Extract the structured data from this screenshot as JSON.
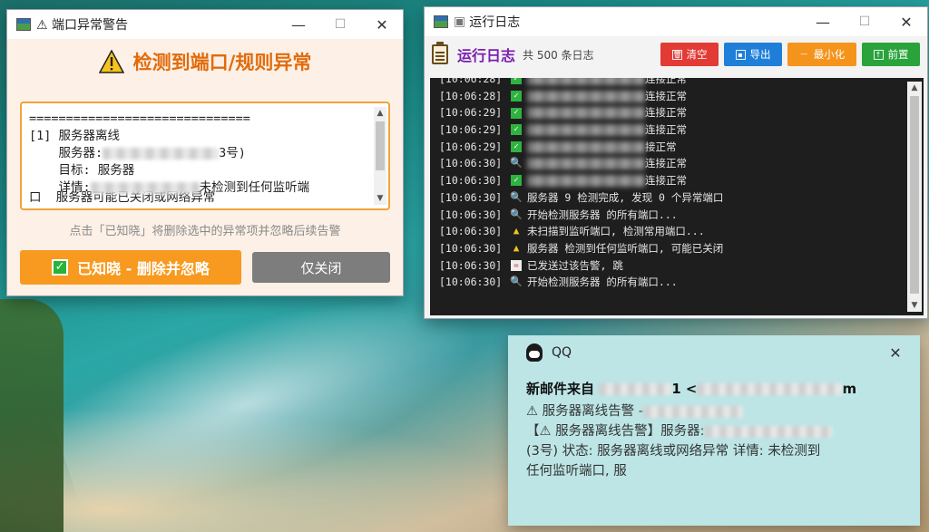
{
  "alert_window": {
    "title": "⚠ 端口异常警告",
    "heading": "检测到端口/规则异常",
    "separator": "==============================",
    "item_header": "[1] 服务器离线",
    "server_label": "    服务器:",
    "server_suffix": "3号)",
    "target_line": "    目标: 服务器",
    "detail_label": "    详情:",
    "detail_suffix": "未检测到任何监听端",
    "cut_line": "口  服务器可能已关闭或网络异常",
    "hint": "点击「已知晓」将删除选中的异常项并忽略后续告警",
    "ack_button": "已知晓 - 删除并忽略",
    "close_button": "仅关闭"
  },
  "log_window": {
    "title": "运行日志",
    "heading": "运行日志",
    "count_text": "共 500 条日志",
    "buttons": {
      "clear": "清空",
      "export": "导出",
      "minimize": "最小化",
      "pin_top": "前置"
    },
    "lines": [
      {
        "time": "[10:06:28]",
        "mark": "ok",
        "text": "连接正常"
      },
      {
        "time": "[10:06:28]",
        "mark": "ok",
        "text": "连接正常"
      },
      {
        "time": "[10:06:29]",
        "mark": "ok",
        "text": "连接正常"
      },
      {
        "time": "[10:06:29]",
        "mark": "ok",
        "text": "连接正常"
      },
      {
        "time": "[10:06:29]",
        "mark": "ok",
        "text": "接正常"
      },
      {
        "time": "[10:06:30]",
        "mark": "search",
        "text": "连接正常"
      },
      {
        "time": "[10:06:30]",
        "mark": "ok",
        "text": "连接正常"
      },
      {
        "time": "[10:06:30]",
        "mark": "search",
        "text": "服务器      9 检测完成, 发现 0 个异常端口"
      },
      {
        "time": "[10:06:30]",
        "mark": "search",
        "text": "开始检测服务器             的所有端口..."
      },
      {
        "time": "[10:06:30]",
        "mark": "warn",
        "text": "未扫描到监听端口, 检测常用端口..."
      },
      {
        "time": "[10:06:30]",
        "mark": "warn",
        "text": "服务器                检测到任何监听端口, 可能已关闭"
      },
      {
        "time": "[10:06:30]",
        "mark": "mail",
        "text": "已发送过该告警, 跳"
      },
      {
        "time": "[10:06:30]",
        "mark": "search",
        "text": "开始检测服务器              的所有端口..."
      }
    ]
  },
  "qq_toast": {
    "app_name": "QQ",
    "sender_prefix": "新邮件来自",
    "sender_mid": "1 <",
    "sender_suffix": "m",
    "subject": "⚠ 服务器离线告警 -",
    "body_line1": "【⚠ 服务器离线告警】服务器:",
    "body_line2": "(3号) 状态: 服务器离线或网络异常 详情: 未检测到",
    "body_line3": "任何监听端口, 服"
  },
  "colors": {
    "alert_accent": "#e16b0b",
    "ack_button": "#f79a1f",
    "log_title": "#7a1fb0",
    "clear_btn": "#e23b35",
    "export_btn": "#1f7fd8",
    "minimize_btn": "#f4941c",
    "pin_btn": "#29a33a",
    "toast_bg": "#bde5e6"
  }
}
